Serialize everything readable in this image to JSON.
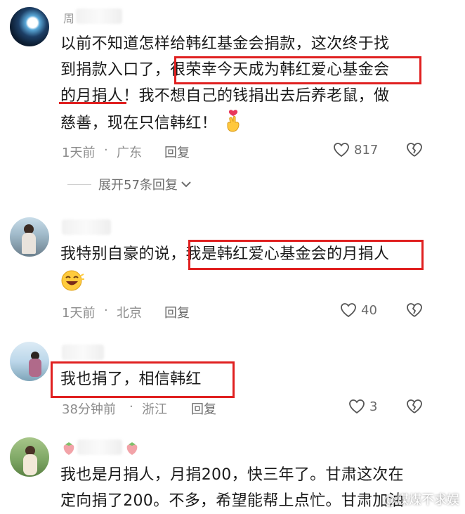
{
  "comments": [
    {
      "username": "周",
      "lines": [
        "以前不知道怎样给韩红基金会捐款，这次终于找",
        "到捐款入口了，很荣幸今天成为韩红爱心基金会",
        "的月捐人！我不想自己的钱捐出去后养老鼠，做",
        "慈善，现在只信韩红！"
      ],
      "emoji_icon": "finger-heart-icon",
      "time": "1天前",
      "location": "广东",
      "reply": "回复",
      "likes": "817"
    },
    {
      "username": "",
      "lines": [
        "我特别自豪的说，我是韩红爱心基金会的月捐人"
      ],
      "emoji_icon": "grinning-face-emoji-icon",
      "time": "1天前",
      "location": "北京",
      "reply": "回复",
      "likes": "40"
    },
    {
      "username": "",
      "lines": [
        "我也捐了，相信韩红"
      ],
      "time": "38分钟前",
      "location": "浙江",
      "reply": "回复",
      "likes": "3"
    },
    {
      "username": "",
      "lines": [
        "我也是月捐人，月捐200，快三年了。甘肃这次在",
        "定向捐了200。不多，希望能帮上点忙。甘肃加油"
      ]
    }
  ],
  "expand_replies": "展开57条回复",
  "dot": "·",
  "watermark": "@煤煤不求娱",
  "colors": {
    "highlight_box": "#e02020",
    "meta_text": "#8c8c8c",
    "body_text": "#1a1a1a"
  }
}
